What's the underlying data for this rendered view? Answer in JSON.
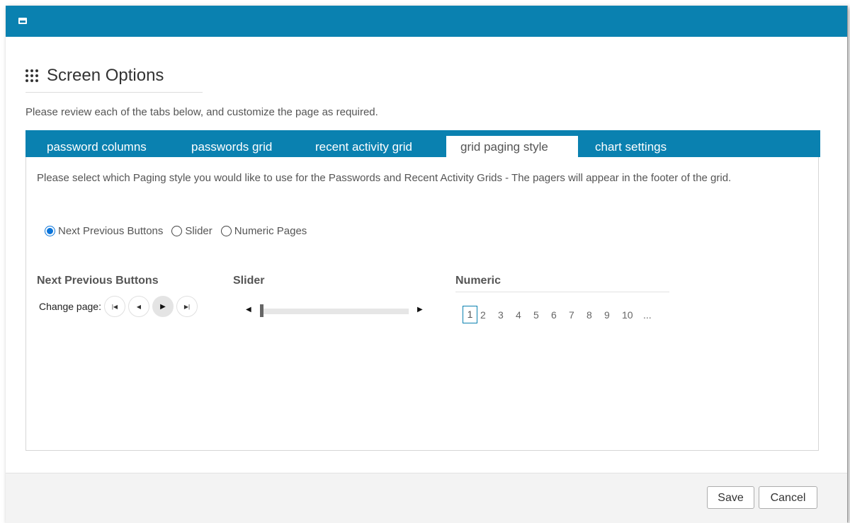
{
  "dialog": {
    "title": "Screen Options",
    "intro": "Please review each of the tabs below, and customize the page as required."
  },
  "tabs": [
    {
      "label": "password columns"
    },
    {
      "label": "passwords grid"
    },
    {
      "label": "recent activity grid"
    },
    {
      "label": "grid paging style",
      "active": true
    },
    {
      "label": "chart settings"
    }
  ],
  "paging": {
    "description": "Please select which Paging style you would like to use for the Passwords and Recent Activity Grids - The pagers will appear in the footer of the grid.",
    "options": [
      {
        "label": "Next Previous Buttons",
        "checked": true
      },
      {
        "label": "Slider",
        "checked": false
      },
      {
        "label": "Numeric Pages",
        "checked": false
      }
    ],
    "sections": {
      "next_previous": "Next Previous Buttons",
      "slider": "Slider",
      "numeric": "Numeric"
    },
    "change_page_label": "Change page:",
    "numeric_pages": [
      "1",
      "2",
      "3",
      "4",
      "5",
      "6",
      "7",
      "8",
      "9",
      "10",
      "..."
    ],
    "current_page": "1"
  },
  "footer": {
    "save_label": "Save",
    "cancel_label": "Cancel"
  },
  "colors": {
    "accent": "#0a81b0",
    "radio_selected": "#0a74d9"
  },
  "icons": {
    "window": "window-icon",
    "grid": "grid-dots-icon",
    "first": "first-page-icon",
    "prev": "prev-page-icon",
    "next": "next-page-icon",
    "last": "last-page-icon"
  }
}
